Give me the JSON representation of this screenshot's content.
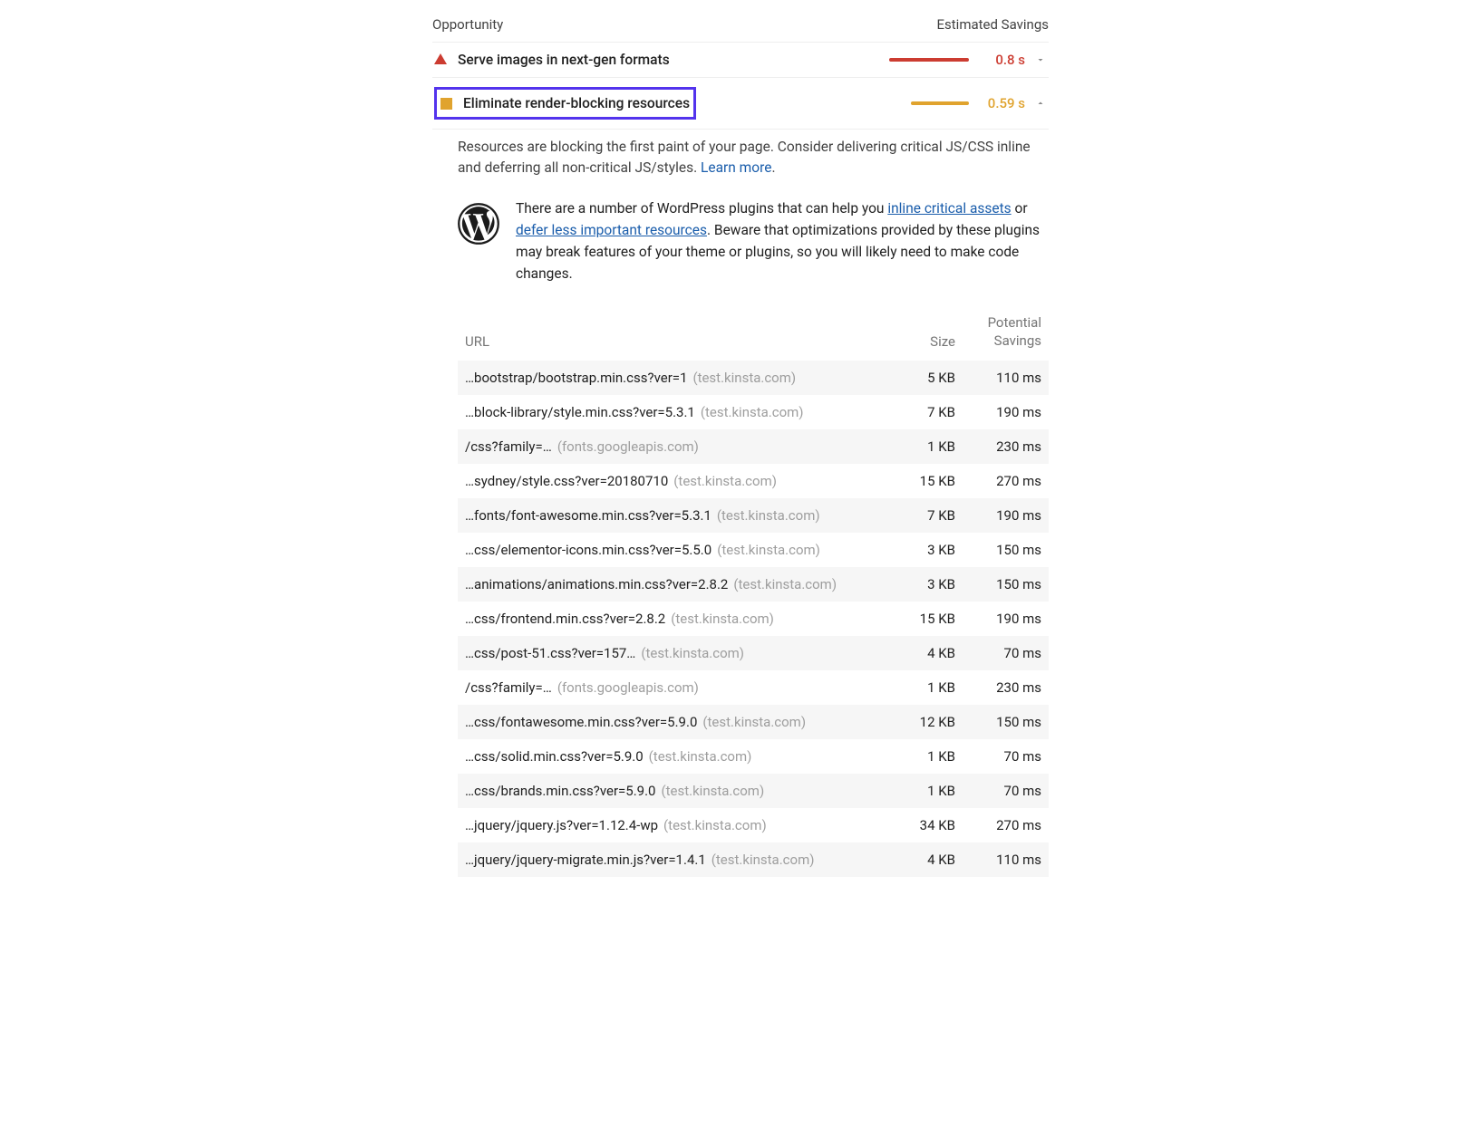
{
  "header": {
    "opportunity": "Opportunity",
    "savings": "Estimated Savings"
  },
  "audits": [
    {
      "title": "Serve images in next-gen formats",
      "savings": "0.8 s",
      "severity": "red",
      "expanded": false
    },
    {
      "title": "Eliminate render-blocking resources",
      "savings": "0.59 s",
      "severity": "orange",
      "expanded": true,
      "highlighted": true
    }
  ],
  "detail": {
    "description_1": "Resources are blocking the first paint of your page. Consider delivering critical JS/CSS inline and deferring all non-critical JS/styles. ",
    "learn_more": "Learn more",
    "wp_text_1": "There are a number of WordPress plugins that can help you ",
    "wp_link_1": "inline critical assets",
    "wp_text_2": " or ",
    "wp_link_2": "defer less important resources",
    "wp_text_3": ". Beware that optimizations provided by these plugins may break features of your theme or plugins, so you will likely need to make code changes."
  },
  "table": {
    "col_url": "URL",
    "col_size": "Size",
    "col_sav_1": "Potential",
    "col_sav_2": "Savings",
    "rows": [
      {
        "url": "…bootstrap/bootstrap.min.css?ver=1",
        "host": "(test.kinsta.com)",
        "size": "5 KB",
        "savings": "110 ms"
      },
      {
        "url": "…block-library/style.min.css?ver=5.3.1",
        "host": "(test.kinsta.com)",
        "size": "7 KB",
        "savings": "190 ms"
      },
      {
        "url": "/css?family=…",
        "host": "(fonts.googleapis.com)",
        "size": "1 KB",
        "savings": "230 ms"
      },
      {
        "url": "…sydney/style.css?ver=20180710",
        "host": "(test.kinsta.com)",
        "size": "15 KB",
        "savings": "270 ms"
      },
      {
        "url": "…fonts/font-awesome.min.css?ver=5.3.1",
        "host": "(test.kinsta.com)",
        "size": "7 KB",
        "savings": "190 ms"
      },
      {
        "url": "…css/elementor-icons.min.css?ver=5.5.0",
        "host": "(test.kinsta.com)",
        "size": "3 KB",
        "savings": "150 ms"
      },
      {
        "url": "…animations/animations.min.css?ver=2.8.2",
        "host": "(test.kinsta.com)",
        "size": "3 KB",
        "savings": "150 ms"
      },
      {
        "url": "…css/frontend.min.css?ver=2.8.2",
        "host": "(test.kinsta.com)",
        "size": "15 KB",
        "savings": "190 ms"
      },
      {
        "url": "…css/post-51.css?ver=157…",
        "host": "(test.kinsta.com)",
        "size": "4 KB",
        "savings": "70 ms"
      },
      {
        "url": "/css?family=…",
        "host": "(fonts.googleapis.com)",
        "size": "1 KB",
        "savings": "230 ms"
      },
      {
        "url": "…css/fontawesome.min.css?ver=5.9.0",
        "host": "(test.kinsta.com)",
        "size": "12 KB",
        "savings": "150 ms"
      },
      {
        "url": "…css/solid.min.css?ver=5.9.0",
        "host": "(test.kinsta.com)",
        "size": "1 KB",
        "savings": "70 ms"
      },
      {
        "url": "…css/brands.min.css?ver=5.9.0",
        "host": "(test.kinsta.com)",
        "size": "1 KB",
        "savings": "70 ms"
      },
      {
        "url": "…jquery/jquery.js?ver=1.12.4-wp",
        "host": "(test.kinsta.com)",
        "size": "34 KB",
        "savings": "270 ms"
      },
      {
        "url": "…jquery/jquery-migrate.min.js?ver=1.4.1",
        "host": "(test.kinsta.com)",
        "size": "4 KB",
        "savings": "110 ms"
      }
    ]
  }
}
